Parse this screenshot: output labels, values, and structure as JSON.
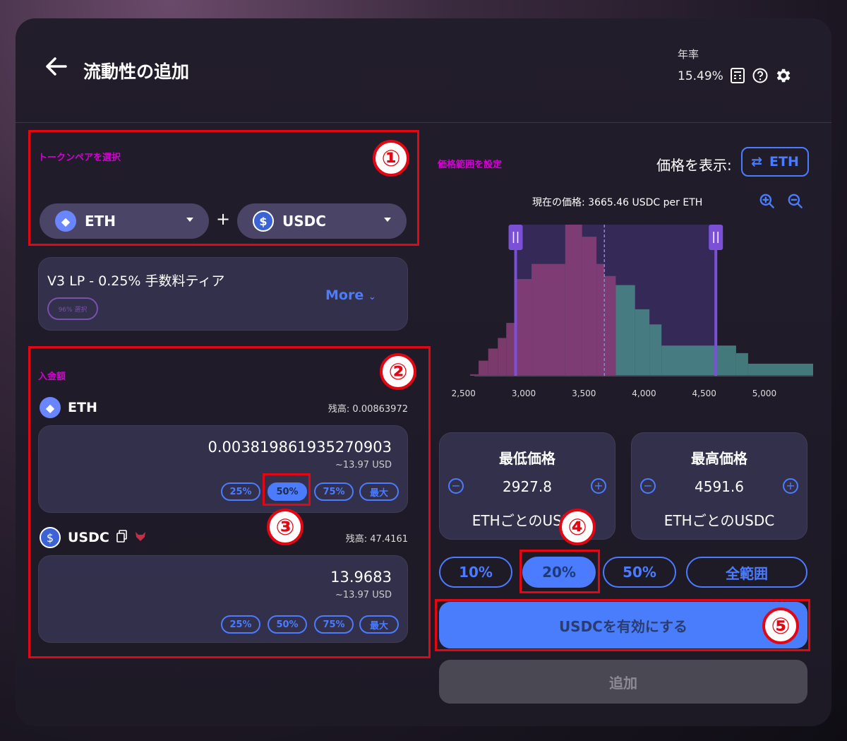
{
  "header": {
    "back_icon": "arrow-left-icon",
    "title": "流動性の追加",
    "apr_label": "年率",
    "apr_value": "15.49%",
    "icons": [
      "calculator-icon",
      "help-icon",
      "gear-icon"
    ]
  },
  "annotations": {
    "n1": "①",
    "n2": "②",
    "n3": "③",
    "n4": "④",
    "n5": "⑤"
  },
  "pair": {
    "label": "トークンペアを選択",
    "token_a": "ETH",
    "token_b": "USDC",
    "plus": "+"
  },
  "tier": {
    "title": "V3 LP - 0.25% 手数料ティア",
    "more": "More",
    "badge": "96% 選択"
  },
  "deposit": {
    "label": "入金額",
    "eth": {
      "symbol": "ETH",
      "balance": "残高: 0.00863972",
      "amount": "0.003819861935270903",
      "usd": "~13.97 USD",
      "pills": [
        "25%",
        "50%",
        "75%",
        "最大"
      ],
      "active_pill": "50%"
    },
    "usdc": {
      "symbol": "USDC",
      "balance": "残高: 47.4161",
      "amount": "13.9683",
      "usd": "~13.97 USD",
      "pills": [
        "25%",
        "50%",
        "75%",
        "最大"
      ]
    }
  },
  "range": {
    "label": "価格範囲を設定",
    "view_price_label": "価格を表示:",
    "view_price_token": "ETH",
    "current_price": "現在の価格: 3665.46 USDC per ETH",
    "min_label": "最低価格",
    "min_value": "2927.8",
    "min_unit": "ETHごとのUSDC",
    "max_label": "最高価格",
    "max_value": "4591.6",
    "max_unit": "ETHごとのUSDC",
    "presets": [
      "10%",
      "20%",
      "50%",
      "全範囲"
    ],
    "active_preset": "20%"
  },
  "actions": {
    "enable": "USDCを有効にする",
    "add": "追加"
  },
  "chart_data": {
    "type": "area",
    "x_ticks": [
      "2,500",
      "3,000",
      "3,500",
      "4,000",
      "4,500",
      "5,000"
    ],
    "xlim": [
      2350,
      5400
    ],
    "current_price": 3665.46,
    "range_min": 2927.8,
    "range_max": 4591.6,
    "colors": {
      "below": "#8b3f78",
      "above": "#4a8a88",
      "handle": "#7b4fd6",
      "range_fill": "#3a2d63"
    },
    "bins": [
      {
        "x": 2350,
        "y": 0.0
      },
      {
        "x": 2550,
        "y": 0.01
      },
      {
        "x": 2620,
        "y": 0.1
      },
      {
        "x": 2700,
        "y": 0.18
      },
      {
        "x": 2780,
        "y": 0.25
      },
      {
        "x": 2850,
        "y": 0.35
      },
      {
        "x": 2930,
        "y": 0.64
      },
      {
        "x": 3060,
        "y": 0.74
      },
      {
        "x": 3340,
        "y": 1.0
      },
      {
        "x": 3480,
        "y": 0.92
      },
      {
        "x": 3600,
        "y": 0.74
      },
      {
        "x": 3665,
        "y": 0.66
      },
      {
        "x": 3760,
        "y": 0.6
      },
      {
        "x": 3920,
        "y": 0.44
      },
      {
        "x": 4040,
        "y": 0.34
      },
      {
        "x": 4140,
        "y": 0.2
      },
      {
        "x": 4760,
        "y": 0.15
      },
      {
        "x": 4860,
        "y": 0.08
      },
      {
        "x": 5400,
        "y": 0.0
      }
    ]
  }
}
